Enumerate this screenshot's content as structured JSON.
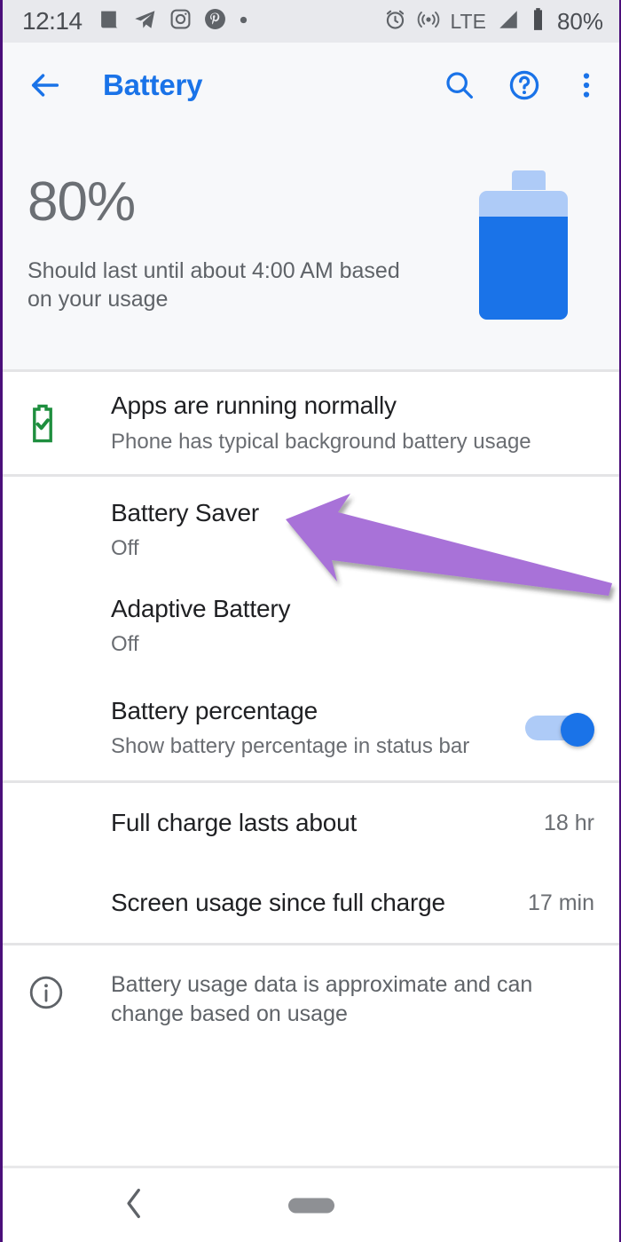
{
  "status_bar": {
    "clock": "12:14",
    "notification_icons": [
      "news-icon",
      "telegram-icon",
      "instagram-icon",
      "pinterest-icon",
      "more-notifications-dot"
    ],
    "alarm_icon": "alarm-clock-icon",
    "hotspot_icon": "hotspot-icon",
    "network_type": "LTE",
    "signal_icon": "signal-bars-icon",
    "battery_icon": "battery-icon",
    "battery_percent": "80%"
  },
  "app_bar": {
    "back_icon": "back-arrow-icon",
    "title": "Battery",
    "search_icon": "search-icon",
    "help_icon": "help-circle-icon",
    "overflow_icon": "overflow-menu-icon",
    "accent_color": "#1a73e8"
  },
  "summary": {
    "percent": "80%",
    "description": "Should last until about 4:00 AM based on your usage",
    "battery_level": 80,
    "battery_fill_color": "#1a73e8",
    "battery_track_color": "#aecbf7"
  },
  "rows": {
    "app_status": {
      "icon": "battery-check-icon",
      "icon_color": "#1e8e3e",
      "title": "Apps are running normally",
      "subtitle": "Phone has typical background battery usage"
    },
    "battery_saver": {
      "title": "Battery Saver",
      "subtitle": "Off"
    },
    "adaptive_battery": {
      "title": "Adaptive Battery",
      "subtitle": "Off"
    },
    "battery_percentage": {
      "title": "Battery percentage",
      "subtitle": "Show battery percentage in status bar",
      "toggle_state": "on",
      "toggle_color": "#1a73e8"
    },
    "full_charge": {
      "title": "Full charge lasts about",
      "value": "18 hr"
    },
    "screen_usage": {
      "title": "Screen usage since full charge",
      "value": "17 min"
    },
    "footer_info": {
      "icon": "info-circle-icon",
      "text": "Battery usage data is approximate and can change based on usage"
    }
  },
  "annotation": {
    "arrow_icon": "purple-arrow-icon",
    "arrow_color": "#a872d8",
    "points_to": "Battery Saver"
  },
  "nav_bar": {
    "back_icon": "nav-back-chevron-icon",
    "home_icon": "nav-home-pill-icon"
  }
}
